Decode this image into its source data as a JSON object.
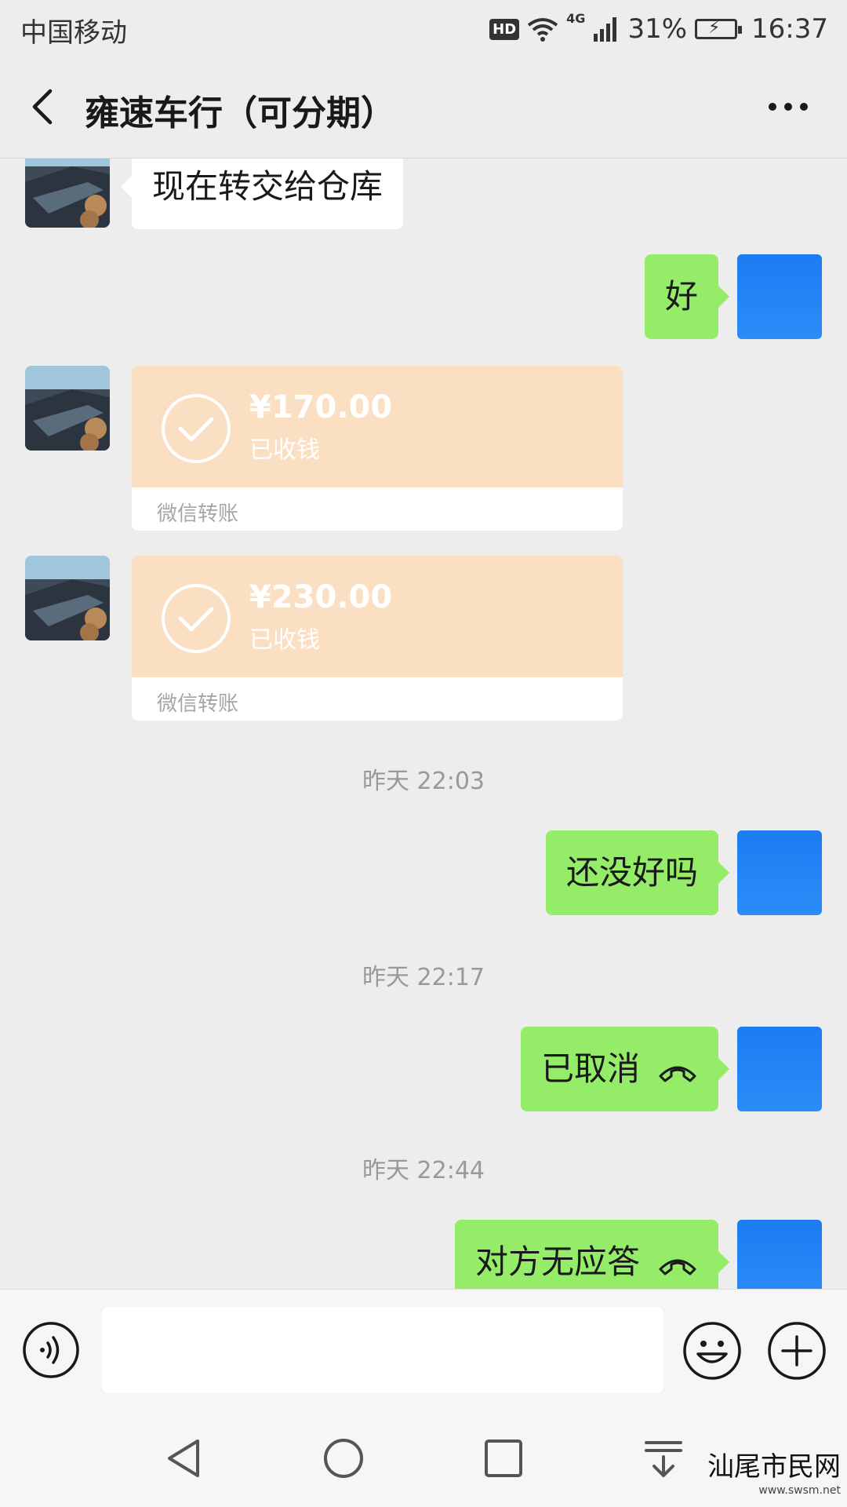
{
  "status_bar": {
    "carrier": "中国移动",
    "hd_badge": "HD",
    "network": "4G",
    "battery": "31%",
    "time": "16:37"
  },
  "header": {
    "title": "雍速车行（可分期）"
  },
  "messages": {
    "m1_text": "现在转交给仓库",
    "m2_text": "好",
    "transfer1": {
      "amount": "¥170.00",
      "status": "已收钱",
      "label": "微信转账"
    },
    "transfer2": {
      "amount": "¥230.00",
      "status": "已收钱",
      "label": "微信转账"
    },
    "ts1": "昨天 22:03",
    "m3_text": "还没好吗",
    "ts2": "昨天 22:17",
    "m4_text": "已取消",
    "ts3": "昨天 22:44",
    "m5_text": "对方无应答"
  },
  "colors": {
    "outgoing_bubble": "#95ec69",
    "transfer_card": "#fbdfc2",
    "self_avatar": "#1e7bf2"
  },
  "watermark": {
    "title": "汕尾市民网",
    "url": "www.swsm.net"
  }
}
